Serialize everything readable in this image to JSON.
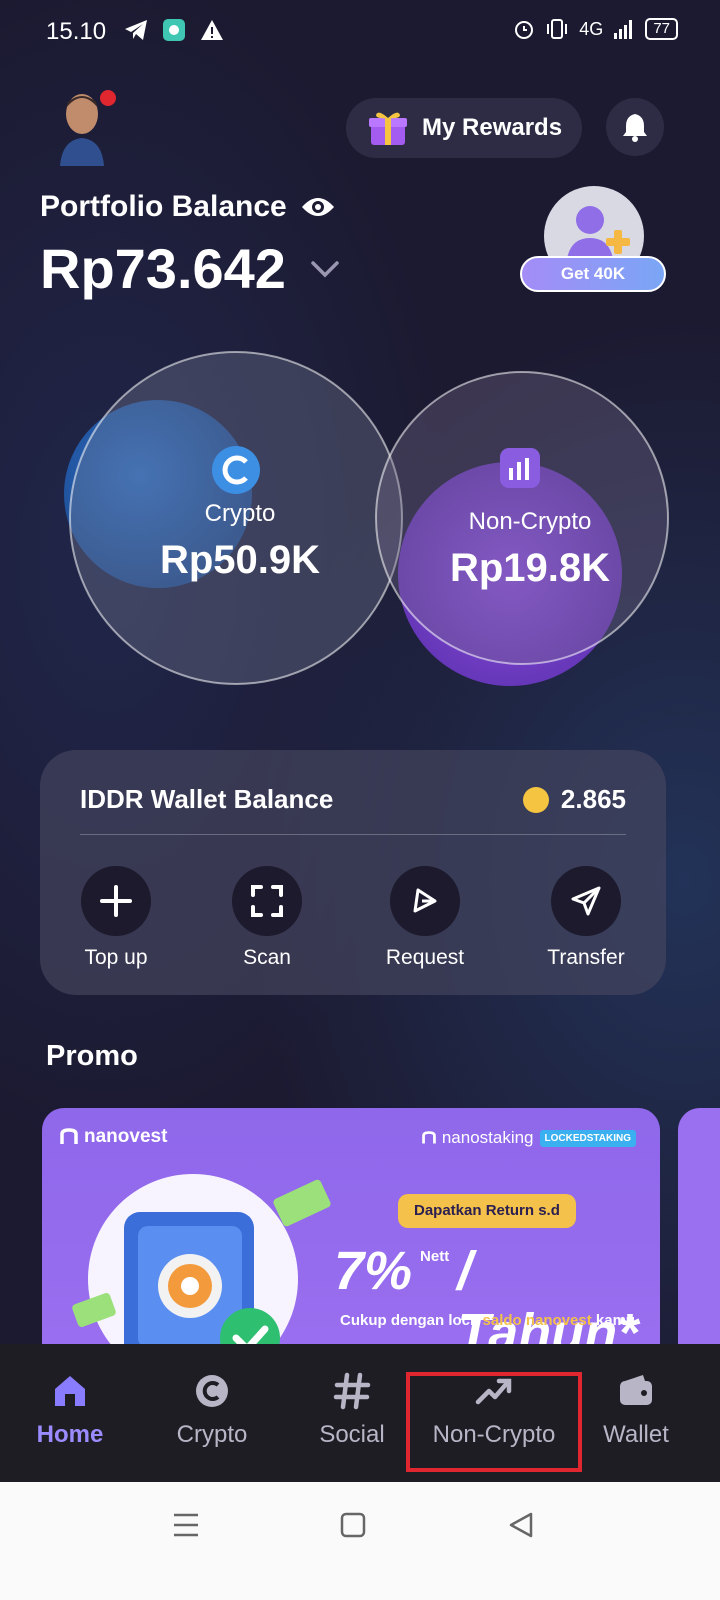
{
  "status_bar": {
    "time": "15.10",
    "network": "4G",
    "battery": "77"
  },
  "header": {
    "rewards_label": "My Rewards"
  },
  "portfolio": {
    "label": "Portfolio Balance",
    "value": "Rp73.642",
    "referral_label": "Get 40K"
  },
  "bubbles": {
    "crypto": {
      "label": "Crypto",
      "value": "Rp50.9K"
    },
    "non_crypto": {
      "label": "Non-Crypto",
      "value": "Rp19.8K"
    }
  },
  "wallet": {
    "title": "IDDR Wallet Balance",
    "balance": "2.865",
    "actions": [
      {
        "label": "Top up",
        "icon": "plus-icon"
      },
      {
        "label": "Scan",
        "icon": "scan-icon"
      },
      {
        "label": "Request",
        "icon": "request-icon"
      },
      {
        "label": "Transfer",
        "icon": "send-icon"
      }
    ]
  },
  "promo": {
    "title": "Promo",
    "card": {
      "brand": "nanovest",
      "product": "nanostaking",
      "badge": "LOCKEDSTAKING",
      "headline_tag": "Dapatkan Return s.d",
      "rate": "7%",
      "rate_suffix": "Nett",
      "period": "/ Tahun*",
      "footnote_pre": "Cukup dengan lock ",
      "footnote_highlight": "saldo nanovest",
      "footnote_post": " kamu"
    }
  },
  "bottom_nav": {
    "items": [
      {
        "label": "Home",
        "icon": "home-icon",
        "active": true
      },
      {
        "label": "Crypto",
        "icon": "crypto-icon",
        "active": false
      },
      {
        "label": "Social",
        "icon": "hashtag-icon",
        "active": false
      },
      {
        "label": "Non-Crypto",
        "icon": "trending-up-icon",
        "active": false
      },
      {
        "label": "Wallet",
        "icon": "wallet-icon",
        "active": false
      }
    ]
  },
  "colors": {
    "accent": "#9a8cff",
    "highlight": "#e0262f",
    "background": "#1c1a31"
  }
}
